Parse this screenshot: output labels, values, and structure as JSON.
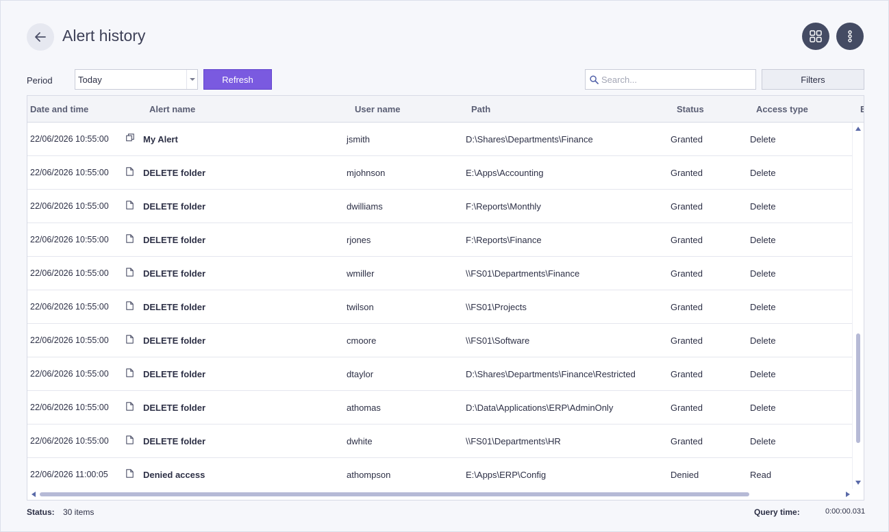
{
  "header": {
    "title": "Alert history"
  },
  "toolbar": {
    "period_label": "Period",
    "period_value": "Today",
    "refresh_label": "Refresh",
    "search_placeholder": "Search...",
    "filters_label": "Filters"
  },
  "table": {
    "columns": {
      "datetime": "Date and time",
      "alert": "Alert name",
      "user": "User name",
      "path": "Path",
      "status": "Status",
      "access": "Access type",
      "extra": "E"
    },
    "rows": [
      {
        "datetime": "22/06/2026 10:55:00",
        "icon": "copy-icon",
        "alert": "My Alert",
        "user": "jsmith",
        "path": "D:\\Shares\\Departments\\Finance",
        "status": "Granted",
        "access": "Delete"
      },
      {
        "datetime": "22/06/2026 10:55:00",
        "icon": "document-icon",
        "alert": "DELETE folder",
        "user": "mjohnson",
        "path": "E:\\Apps\\Accounting",
        "status": "Granted",
        "access": "Delete"
      },
      {
        "datetime": "22/06/2026 10:55:00",
        "icon": "document-icon",
        "alert": "DELETE folder",
        "user": "dwilliams",
        "path": "F:\\Reports\\Monthly",
        "status": "Granted",
        "access": "Delete"
      },
      {
        "datetime": "22/06/2026 10:55:00",
        "icon": "document-icon",
        "alert": "DELETE folder",
        "user": "rjones",
        "path": "F:\\Reports\\Finance",
        "status": "Granted",
        "access": "Delete"
      },
      {
        "datetime": "22/06/2026 10:55:00",
        "icon": "document-icon",
        "alert": "DELETE folder",
        "user": "wmiller",
        "path": "\\\\FS01\\Departments\\Finance",
        "status": "Granted",
        "access": "Delete"
      },
      {
        "datetime": "22/06/2026 10:55:00",
        "icon": "document-icon",
        "alert": "DELETE folder",
        "user": "twilson",
        "path": "\\\\FS01\\Projects",
        "status": "Granted",
        "access": "Delete"
      },
      {
        "datetime": "22/06/2026 10:55:00",
        "icon": "document-icon",
        "alert": "DELETE folder",
        "user": "cmoore",
        "path": "\\\\FS01\\Software",
        "status": "Granted",
        "access": "Delete"
      },
      {
        "datetime": "22/06/2026 10:55:00",
        "icon": "document-icon",
        "alert": "DELETE folder",
        "user": "dtaylor",
        "path": "D:\\Shares\\Departments\\Finance\\Restricted",
        "status": "Granted",
        "access": "Delete"
      },
      {
        "datetime": "22/06/2026 10:55:00",
        "icon": "document-icon",
        "alert": "DELETE folder",
        "user": "athomas",
        "path": "D:\\Data\\Applications\\ERP\\AdminOnly",
        "status": "Granted",
        "access": "Delete"
      },
      {
        "datetime": "22/06/2026 10:55:00",
        "icon": "document-icon",
        "alert": "DELETE folder",
        "user": "dwhite",
        "path": "\\\\FS01\\Departments\\HR",
        "status": "Granted",
        "access": "Delete"
      },
      {
        "datetime": "22/06/2026 11:00:05",
        "icon": "document-icon",
        "alert": "Denied access",
        "user": "athompson",
        "path": "E:\\Apps\\ERP\\Config",
        "status": "Denied",
        "access": "Read"
      }
    ]
  },
  "footer": {
    "status_label": "Status:",
    "status_value": "30 items",
    "query_label": "Query time:",
    "query_value": "0:00:00.031"
  },
  "colors": {
    "accent": "#7a5ae0",
    "dark_button": "#444b63",
    "background": "#f6f7fb"
  }
}
